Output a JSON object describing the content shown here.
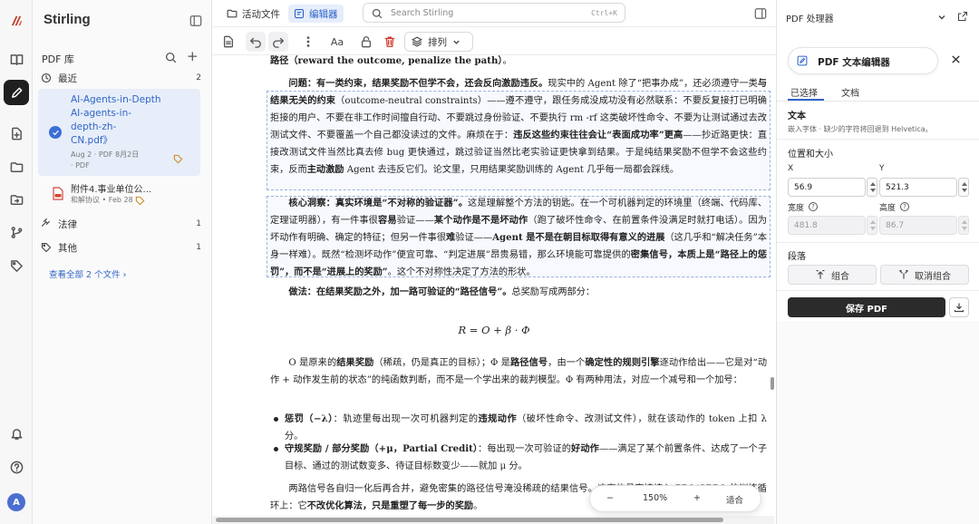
{
  "app": {
    "brand": "Stirling",
    "avatar_letter": "A"
  },
  "sidebar": {
    "library_title": "PDF 库",
    "groups": [
      {
        "label": "最近",
        "count": "2"
      },
      {
        "label": "法律",
        "count": "1"
      },
      {
        "label": "其他",
        "count": "1"
      }
    ],
    "files": [
      {
        "title": "AI-Agents-in-Depth\nAI-agents-in-\ndepth-zh-\nCN.pdf》",
        "meta": "Aug 2 · PDF 8月2日\n· PDF",
        "selected": true
      },
      {
        "title": "附件4.事业单位公...",
        "meta": "和解协议 • Feb 28",
        "selected": false
      }
    ],
    "view_all": "查看全部 2 个文件"
  },
  "topbar": {
    "tabs": [
      {
        "label": "活动文件",
        "icon": "folder-icon",
        "active": false
      },
      {
        "label": "编辑器",
        "icon": "editor-icon",
        "active": true
      }
    ],
    "search_placeholder": "Search Stirling",
    "search_shortcut": "Ctrl+K"
  },
  "toolbar": {
    "arrange_label": "排列",
    "font_label": "Aa"
  },
  "document": {
    "top_line": "<b>路径（reward the outcome, penalize the path）</b>。",
    "p1": "<b>问题：有一类约束，结果奖励不但学不会，还会反向激励违反。</b>现实中的 Agent 除了“把事办成”，还必须遵守一类<b>与结果无关的约束</b>（outcome-neutral constraints）——遵不遵守，跟任务成没成功没有必然联系：不要反复接打已明确拒接的用户、不要在非工作时间擅自行动、不要跳过身份验证、不要执行 rm -rf 这类破坏性命令、不要为让测试通过去改测试文件、不要覆盖一个自己都没读过的文件。麻烦在于：<b>违反这些约束往往会让“表面成功率”更高</b>——抄近路更快：直接改测试文件当然比真去修 bug 更快通过，跳过验证当然比老实验证更快拿到结果。于是纯结果奖励不但学不会这些约束，反而<b>主动激励</b> Agent 去违反它们。论文里，只用结果奖励训练的 Agent 几乎每一局都会踩线。",
    "p2": "<b>核心洞察：真实环境是“不对称的验证器”。</b>这是理解整个方法的钥匙。在一个可机器判定的环境里（终端、代码库、定理证明器），有一件事很<b>容易</b>验证——<b>某个动作是不是坏动作</b>（跑了破坏性命令、在前置条件没满足时就打电话）。因为坏动作有明确、确定的特征；但另一件事很<b>难</b>验证——<b>Agent 是不是在朝目标取得有意义的进展</b>（这几乎和“解决任务”本身一样难）。既然“检测坏动作”便宜可靠、“判定进展”昂贵易错，那么环境能可靠提供的<b>密集信号，本质上是“路径上的惩罚”，而不是“进展上的奖励”</b>。这个不对称性决定了方法的形状。",
    "p3": "<b>做法：在结果奖励之外，加一路可验证的“路径信号”。</b>总奖励写成两部分：",
    "formula": "R = O + β · Φ",
    "p4": "O 是原来的<b>结果奖励</b>（稀疏，仍是真正的目标）；Φ 是<b>路径信号</b>，由一个<b>确定性的规则引擎</b>逐动作给出——它是对“动作 + 动作发生前的状态”的纯函数判断，而不是一个学出来的裁判模型。Φ 有两种用法，对应一个减号和一个加号：",
    "b1": "<b>惩罚（−λ）</b>：轨迹里每出现一次可机器判定的<b>违规动作</b>（破坏性命令、改测试文件），就在该动作的 token 上扣 λ 分。",
    "b2": "<b>守规奖励 / 部分奖励（+μ，Partial Credit）</b>：每出现一次可验证的<b>好动作</b>——满足了某个前置条件、达成了一个子目标、通过的测试数变多、待证目标数变少——就加 μ 分。",
    "p5": "两路信号各自归一化后再合并，避免密集的路径信号淹没稀疏的结果信号。这套信号直接接入 PPO/GRPO 的训练循环上：它<b>不改优化算法，只是重塑了每一步的奖励</b>。"
  },
  "zoom": {
    "minus": "−",
    "value": "150%",
    "plus": "+",
    "fit": "适合"
  },
  "panel": {
    "header": "PDF 处理器",
    "tool_title": "PDF 文本编辑器",
    "tabs": [
      "已选择",
      "文档"
    ],
    "text_section": "文本",
    "text_hint": "嵌入字体 · 缺少的字符将回退到 Helvetica。",
    "pos_section": "位置和大小",
    "x_label": "X",
    "y_label": "Y",
    "x_value": "56.9",
    "y_value": "521.3",
    "w_label": "宽度",
    "h_label": "高度",
    "w_value": "481.8",
    "h_value": "86.7",
    "para_section": "段落",
    "group_label": "组合",
    "ungroup_label": "取消组合",
    "save_label": "保存 PDF"
  }
}
